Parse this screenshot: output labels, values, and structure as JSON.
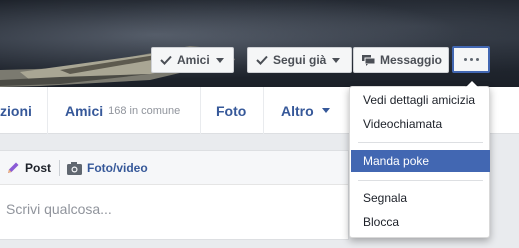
{
  "cover_buttons": {
    "friends": {
      "label": "Amici",
      "icon": "check-icon"
    },
    "following": {
      "label": "Segui già",
      "icon": "check-icon"
    },
    "message": {
      "label": "Messaggio",
      "icon": "message-icon"
    },
    "more": {
      "icon": "more-dots-icon"
    }
  },
  "tabs": [
    {
      "label": "zioni"
    },
    {
      "label": "Amici",
      "sub": "168 in comune"
    },
    {
      "label": "Foto"
    },
    {
      "label": "Altro",
      "icon": "caret-down-icon"
    }
  ],
  "composer": {
    "post_label": "Post",
    "photo_label": "Foto/video",
    "placeholder": "Scrivi qualcosa..."
  },
  "dropdown_menu": {
    "items": [
      {
        "label": "Vedi dettagli amicizia"
      },
      {
        "label": "Videochiamata"
      },
      {
        "label": "Manda poke",
        "highlighted": true
      },
      {
        "label": "Segnala"
      },
      {
        "label": "Blocca"
      }
    ]
  },
  "colors": {
    "accent": "#4267b2",
    "link": "#365899",
    "background": "#e9ebee"
  }
}
